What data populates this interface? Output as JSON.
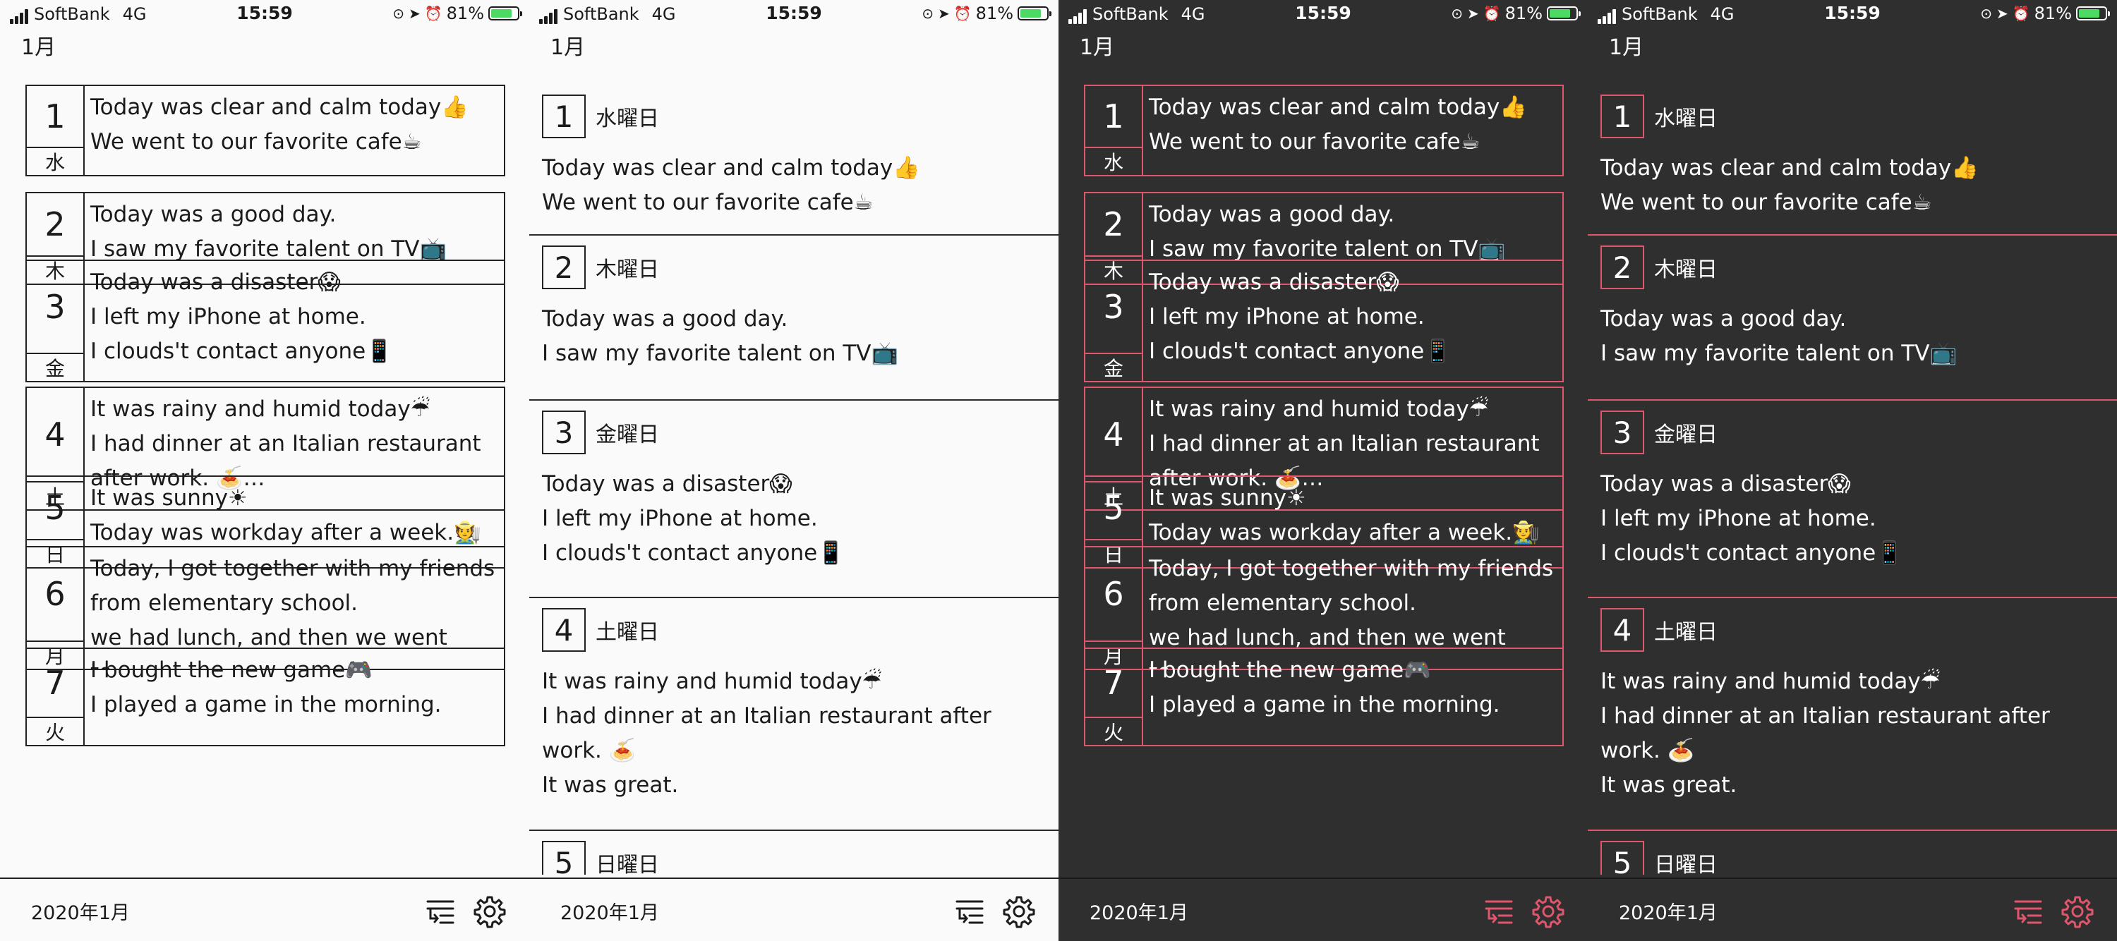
{
  "status": {
    "carrier": "SoftBank",
    "network": "4G",
    "time": "15:59",
    "battery": "81%",
    "battery_level": 0.81
  },
  "month_label": "1月",
  "footer": {
    "label": "2020年1月"
  },
  "colors": {
    "accent": "#e0566d",
    "dark_bg": "#302f2f",
    "light_bg": "#fafafa"
  },
  "cards": [
    {
      "day": "1",
      "weekday": "水",
      "text": "Today was clear and calm today👍\nWe went to our favorite cafe☕"
    },
    {
      "day": "2",
      "weekday": "木",
      "text": "Today was a good day.\nI saw my favorite talent on TV📺"
    },
    {
      "day": "3",
      "weekday": "金",
      "text": "Today was a disaster😱\nI left my iPhone at home.\nI clouds't contact anyone📱"
    },
    {
      "day": "4",
      "weekday": "土",
      "text": "It was rainy and humid today☔\nI had dinner at an Italian restaurant\nafter work. 🍝…"
    },
    {
      "day": "5",
      "weekday": "日",
      "text": "It was sunny☀\nToday was workday after a week.🧑‍🌾"
    },
    {
      "day": "6",
      "weekday": "月",
      "text": "Today, I got together with my friends\nfrom elementary school.\nwe had lunch, and then we went to…"
    },
    {
      "day": "7",
      "weekday": "火",
      "text": "I bought the new game🎮\nI played a game in the morning."
    }
  ],
  "rows": [
    {
      "day": "1",
      "weekday": "水曜日",
      "text": "Today was clear and calm today👍\nWe went to our favorite cafe☕"
    },
    {
      "day": "2",
      "weekday": "木曜日",
      "text": "Today was a good day.\nI saw my favorite talent on TV📺"
    },
    {
      "day": "3",
      "weekday": "金曜日",
      "text": "Today was a disaster😱\nI left my iPhone at home.\nI clouds't contact anyone📱"
    },
    {
      "day": "4",
      "weekday": "土曜日",
      "text": "It was rainy and humid today☔\nI had dinner at an Italian restaurant after\nwork. 🍝\nIt was great."
    },
    {
      "day": "5",
      "weekday": "日曜日",
      "text": ""
    }
  ],
  "icons": {
    "sort": "sort-list-icon",
    "settings": "gear-icon"
  }
}
